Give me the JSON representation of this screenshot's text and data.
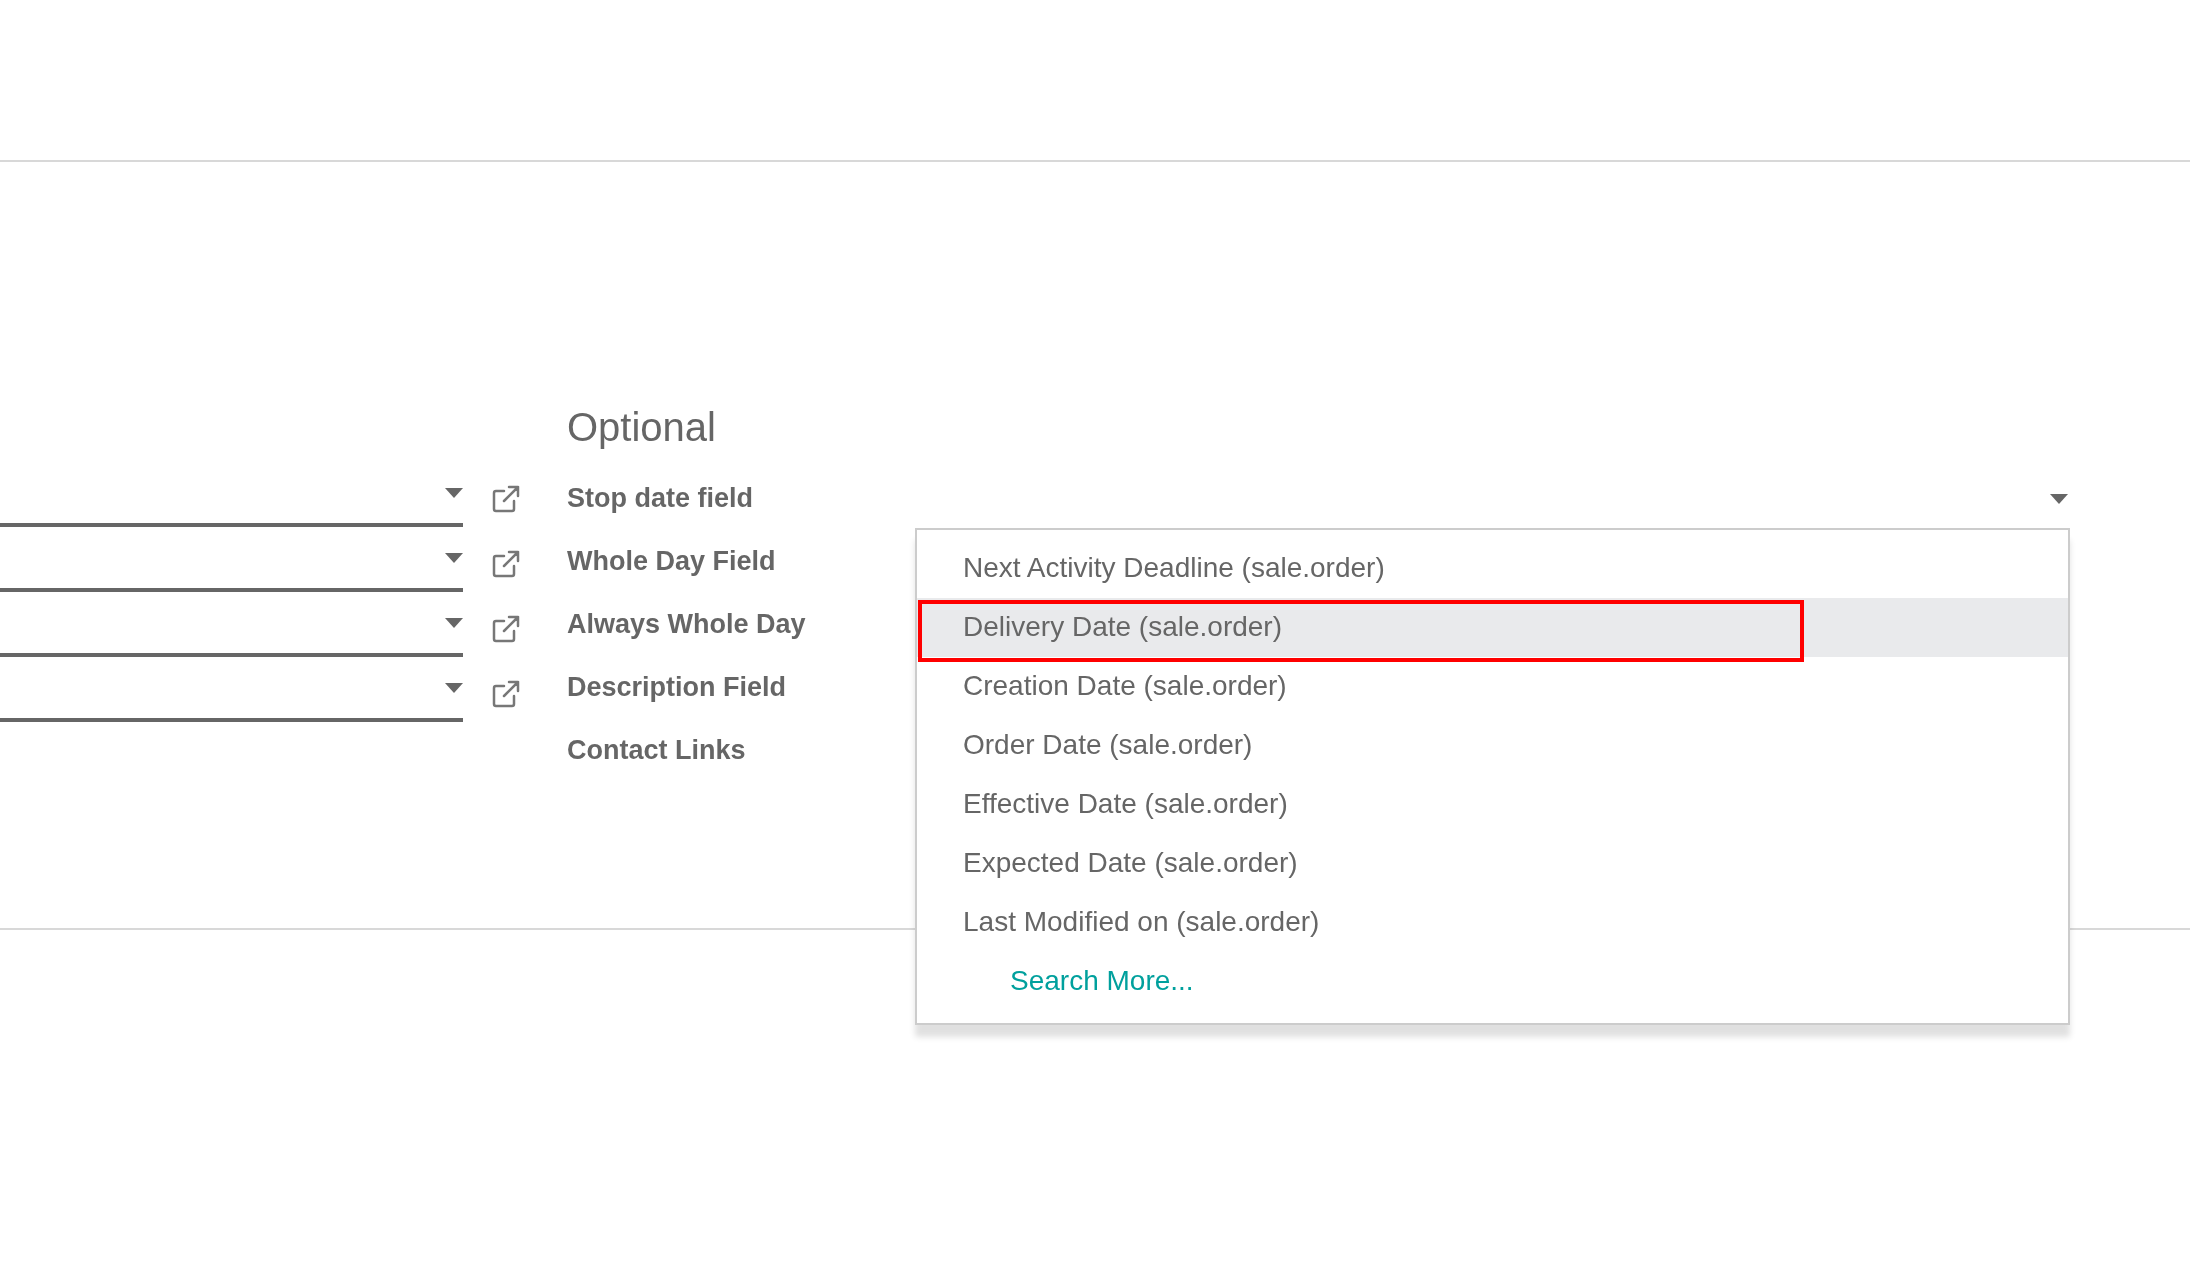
{
  "left_fields": [
    {
      "kind": "select"
    },
    {
      "kind": "select"
    },
    {
      "kind": "select"
    },
    {
      "kind": "select"
    }
  ],
  "section": {
    "title": "Optional",
    "fields": [
      {
        "label": "Stop date field",
        "kind": "select",
        "open": true
      },
      {
        "label": "Whole Day Field",
        "kind": "plain"
      },
      {
        "label": "Always Whole Day",
        "kind": "plain"
      },
      {
        "label": "Description Field",
        "kind": "plain"
      },
      {
        "label": "Contact Links",
        "kind": "plain"
      }
    ]
  },
  "dropdown": {
    "options": [
      {
        "label": "Next Activity Deadline (sale.order)",
        "selected": false,
        "outlined": false
      },
      {
        "label": "Delivery Date (sale.order)",
        "selected": true,
        "outlined": true
      },
      {
        "label": "Creation Date (sale.order)",
        "selected": false,
        "outlined": false
      },
      {
        "label": "Order Date (sale.order)",
        "selected": false,
        "outlined": false
      },
      {
        "label": "Effective Date (sale.order)",
        "selected": false,
        "outlined": false
      },
      {
        "label": "Expected Date (sale.order)",
        "selected": false,
        "outlined": false
      },
      {
        "label": "Last Modified on (sale.order)",
        "selected": false,
        "outlined": false
      }
    ],
    "search_more": "Search More..."
  }
}
